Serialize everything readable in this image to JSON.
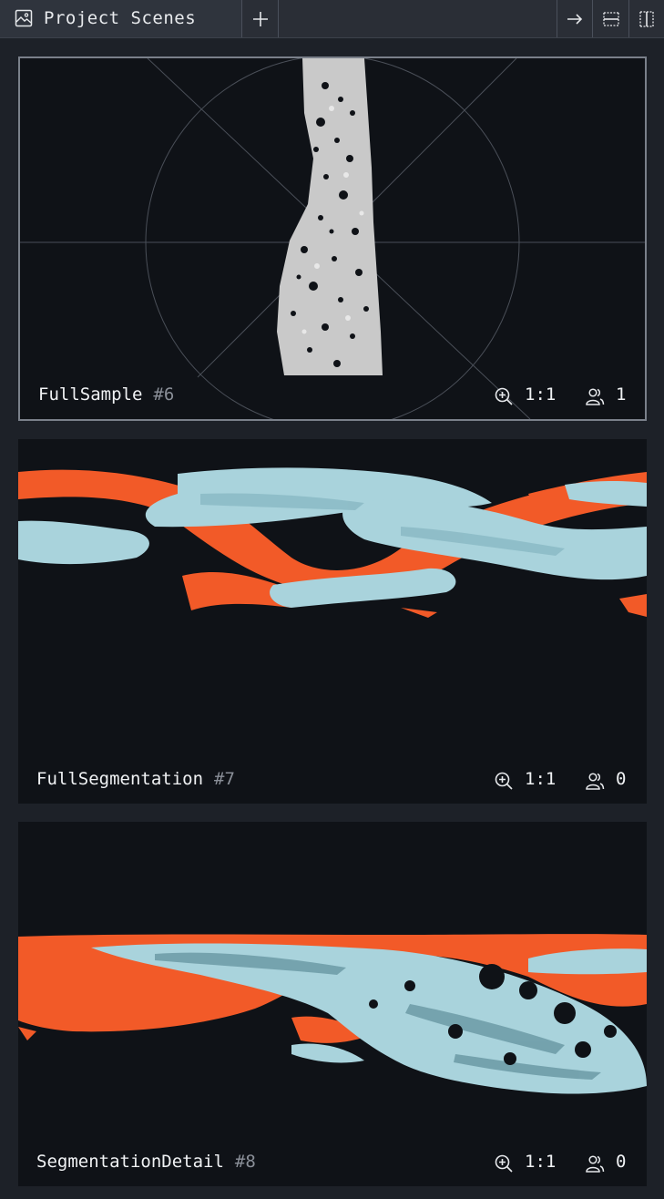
{
  "header": {
    "title": "Project Scenes",
    "icons": [
      "scene-image-icon",
      "plus-icon",
      "arrow-right-icon",
      "horizontal-split-icon",
      "vertical-split-icon"
    ]
  },
  "scenes": [
    {
      "name": "FullSample",
      "number": "#6",
      "zoom": "1:1",
      "users": "1",
      "selected": true
    },
    {
      "name": "FullSegmentation",
      "number": "#7",
      "zoom": "1:1",
      "users": "0",
      "selected": false
    },
    {
      "name": "SegmentationDetail",
      "number": "#8",
      "zoom": "1:1",
      "users": "0",
      "selected": false
    }
  ],
  "colors": {
    "background": "#1d2128",
    "viewport": "#0f1217",
    "segment_orange": "#f25a28",
    "segment_blue": "#a9d3dc",
    "sample_gray": "#c8c8c8"
  }
}
